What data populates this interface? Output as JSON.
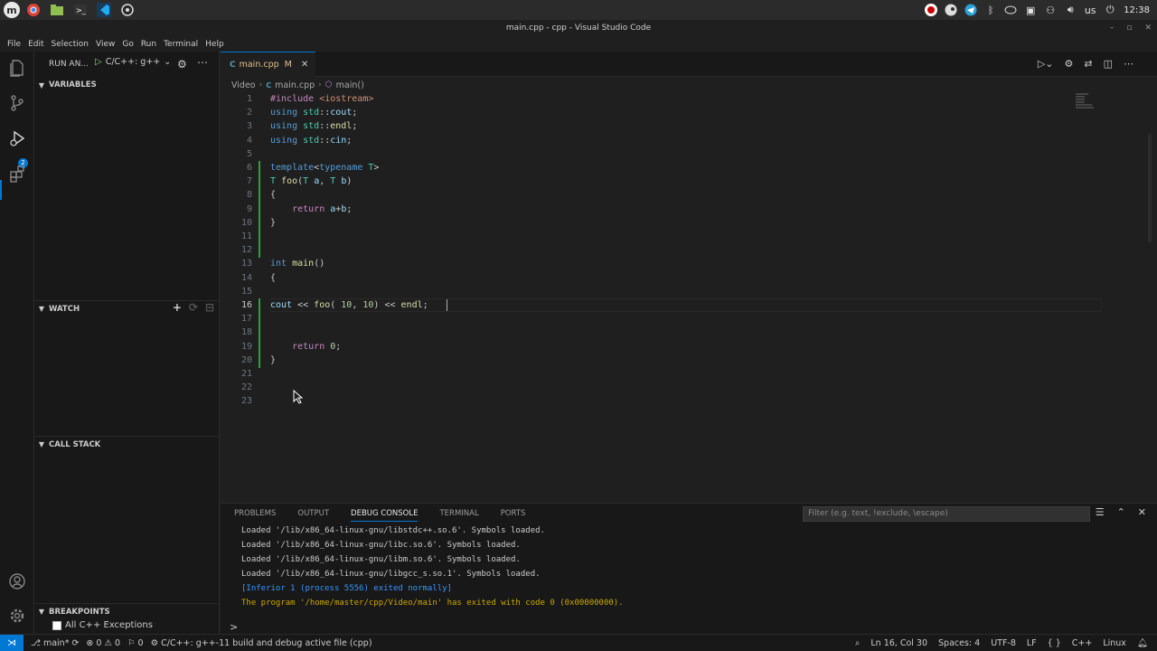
{
  "os": {
    "launcher": "m",
    "tray": {
      "lang": "us",
      "time": "12:38"
    }
  },
  "window": {
    "title": "main.cpp - cpp - Visual Studio Code"
  },
  "menu": [
    "File",
    "Edit",
    "Selection",
    "View",
    "Go",
    "Run",
    "Terminal",
    "Help"
  ],
  "activity": {
    "scm_badge": "2"
  },
  "sidebar": {
    "title": "RUN AN...",
    "config": "C/C++: g++",
    "sections": {
      "variables": "VARIABLES",
      "watch": "WATCH",
      "callstack": "CALL STACK",
      "breakpoints": "BREAKPOINTS"
    },
    "breakpoint_item": "All C++ Exceptions"
  },
  "tabs": [
    {
      "label": "main.cpp",
      "status": "M",
      "icon": "C"
    }
  ],
  "breadcrumb": {
    "folder": "Video",
    "file": "main.cpp",
    "symbol": "main()"
  },
  "code": {
    "current_line": 16,
    "lines": [
      {
        "n": "1",
        "tokens": [
          [
            "dir",
            "#include "
          ],
          [
            "str",
            "<iostream>"
          ]
        ]
      },
      {
        "n": "2",
        "tokens": [
          [
            "kw",
            "using "
          ],
          [
            "ty",
            "std"
          ],
          [
            "",
            "::"
          ],
          [
            "var",
            "cout"
          ],
          [
            "",
            ";"
          ]
        ]
      },
      {
        "n": "3",
        "tokens": [
          [
            "kw",
            "using "
          ],
          [
            "ty",
            "std"
          ],
          [
            "",
            "::"
          ],
          [
            "fn",
            "endl"
          ],
          [
            "",
            ";"
          ]
        ]
      },
      {
        "n": "4",
        "tokens": [
          [
            "kw",
            "using "
          ],
          [
            "ty",
            "std"
          ],
          [
            "",
            "::"
          ],
          [
            "var",
            "cin"
          ],
          [
            "",
            ";"
          ]
        ]
      },
      {
        "n": "5",
        "tokens": []
      },
      {
        "n": "6",
        "tokens": [
          [
            "kw",
            "template"
          ],
          [
            "",
            "<"
          ],
          [
            "kw",
            "typename "
          ],
          [
            "ty",
            "T"
          ],
          [
            "",
            ">"
          ]
        ]
      },
      {
        "n": "7",
        "tokens": [
          [
            "ty",
            "T "
          ],
          [
            "fn",
            "foo"
          ],
          [
            "",
            "("
          ],
          [
            "ty",
            "T "
          ],
          [
            "var",
            "a"
          ],
          [
            "",
            ", "
          ],
          [
            "ty",
            "T "
          ],
          [
            "var",
            "b"
          ],
          [
            "",
            ")"
          ]
        ]
      },
      {
        "n": "8",
        "tokens": [
          [
            "",
            "{"
          ]
        ]
      },
      {
        "n": "9",
        "tokens": [
          [
            "",
            "    "
          ],
          [
            "kw2",
            "return "
          ],
          [
            "var",
            "a"
          ],
          [
            "",
            "+"
          ],
          [
            "var",
            "b"
          ],
          [
            "",
            ";"
          ]
        ]
      },
      {
        "n": "10",
        "tokens": [
          [
            "",
            "}"
          ]
        ]
      },
      {
        "n": "11",
        "tokens": []
      },
      {
        "n": "12",
        "tokens": []
      },
      {
        "n": "13",
        "tokens": [
          [
            "kw",
            "int "
          ],
          [
            "fn",
            "main"
          ],
          [
            "",
            "()"
          ]
        ]
      },
      {
        "n": "14",
        "tokens": [
          [
            "",
            "{"
          ]
        ]
      },
      {
        "n": "15",
        "tokens": []
      },
      {
        "n": "16",
        "tokens": [
          [
            "var",
            "cout "
          ],
          [
            "",
            "<< "
          ],
          [
            "fn",
            "foo"
          ],
          [
            "",
            "( "
          ],
          [
            "num",
            "10"
          ],
          [
            "",
            ", "
          ],
          [
            "num",
            "10"
          ],
          [
            "",
            ") << "
          ],
          [
            "fn",
            "endl"
          ],
          [
            "",
            ";"
          ]
        ]
      },
      {
        "n": "17",
        "tokens": []
      },
      {
        "n": "18",
        "tokens": []
      },
      {
        "n": "19",
        "tokens": [
          [
            "",
            "    "
          ],
          [
            "kw2",
            "return "
          ],
          [
            "num",
            "0"
          ],
          [
            "",
            ";"
          ]
        ]
      },
      {
        "n": "20",
        "tokens": [
          [
            "",
            "}"
          ]
        ]
      },
      {
        "n": "21",
        "tokens": []
      },
      {
        "n": "22",
        "tokens": []
      },
      {
        "n": "23",
        "tokens": []
      }
    ]
  },
  "panel": {
    "tabs": [
      "PROBLEMS",
      "OUTPUT",
      "DEBUG CONSOLE",
      "TERMINAL",
      "PORTS"
    ],
    "active_tab": "DEBUG CONSOLE",
    "filter_placeholder": "Filter (e.g. text, !exclude, \\escape)",
    "console": [
      {
        "text": "Loaded '/lib/x86_64-linux-gnu/libstdc++.so.6'. Symbols loaded.",
        "color": ""
      },
      {
        "text": "Loaded '/lib/x86_64-linux-gnu/libc.so.6'. Symbols loaded.",
        "color": ""
      },
      {
        "text": "Loaded '/lib/x86_64-linux-gnu/libm.so.6'. Symbols loaded.",
        "color": ""
      },
      {
        "text": "Loaded '/lib/x86_64-linux-gnu/libgcc_s.so.1'. Symbols loaded.",
        "color": ""
      },
      {
        "text": "[Inferior 1 (process 5556) exited normally]",
        "color": "blue"
      },
      {
        "text": "The program '/home/master/cpp/Video/main' has exited with code 0 (0x00000000).",
        "color": "yellow"
      }
    ],
    "prompt": ">"
  },
  "status": {
    "branch": "main*",
    "errors": "0",
    "warnings": "0",
    "info": "0",
    "launch": "C/C++: g++-11 build and debug active file (cpp)",
    "position": "Ln 16, Col 30",
    "spaces": "Spaces: 4",
    "encoding": "UTF-8",
    "eol": "LF",
    "language": "C++",
    "platform": "Linux"
  },
  "colors": {
    "accent": "#0078d4",
    "modified": "#e2c08d",
    "gutter_added": "#2ea043"
  }
}
